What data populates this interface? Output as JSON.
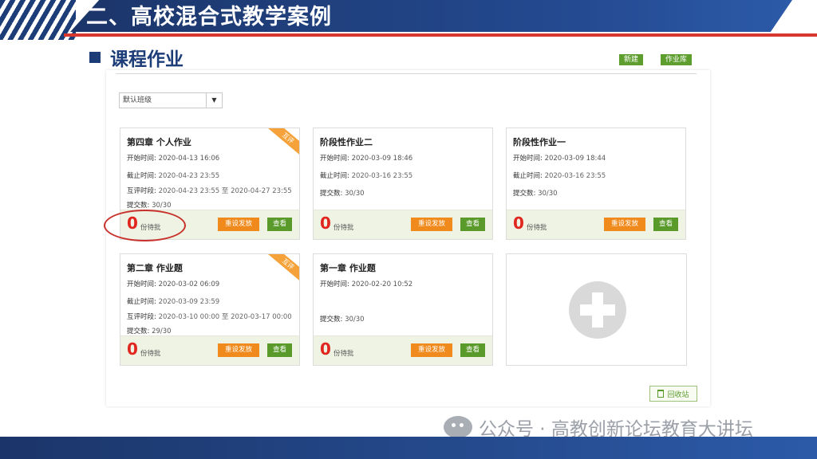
{
  "header": {
    "title": "二、高校混合式教学案例"
  },
  "section": {
    "title": "课程作业"
  },
  "toolbar": {
    "new_label": "新建",
    "library_label": "作业库"
  },
  "filter": {
    "class_select_value": "默认班级"
  },
  "labels": {
    "start": "开始时间:",
    "deadline": "截止时间:",
    "peer_review": "互评时段:",
    "submitted": "提交数:",
    "pending_suffix": "份待批",
    "reset_button": "重设发放",
    "view_button": "查看",
    "peer_badge": "互评",
    "to": "至"
  },
  "assignments": [
    {
      "title": "第四章 个人作业",
      "start": "2020-04-13 16:06",
      "deadline": "2020-04-23 23:55",
      "peer_from": "2020-04-23 23:55",
      "peer_to": "2020-04-27 23:55",
      "submitted": "30/30",
      "pending": "0",
      "peer": true
    },
    {
      "title": "阶段性作业二",
      "start": "2020-03-09 18:46",
      "deadline": "2020-03-16 23:55",
      "submitted": "30/30",
      "pending": "0",
      "peer": false
    },
    {
      "title": "阶段性作业一",
      "start": "2020-03-09 18:44",
      "deadline": "2020-03-16 23:55",
      "submitted": "30/30",
      "pending": "0",
      "peer": false
    },
    {
      "title": "第二章 作业题",
      "start": "2020-03-02 06:09",
      "deadline": "2020-03-09 23:59",
      "peer_from": "2020-03-10 00:00",
      "peer_to": "2020-03-17 00:00",
      "submitted": "29/30",
      "pending": "0",
      "peer": true
    },
    {
      "title": "第一章 作业题",
      "start": "2020-02-20 10:52",
      "submitted": "30/30",
      "pending": "0",
      "peer": false
    }
  ],
  "recycle": {
    "label": "回收站"
  },
  "watermark": {
    "text": "公众号 · 高教创新论坛教育大讲坛"
  },
  "colors": {
    "accent": "#1d3d78",
    "orange": "#f08a1c",
    "green": "#5a9a2b",
    "red": "#e0261e"
  }
}
